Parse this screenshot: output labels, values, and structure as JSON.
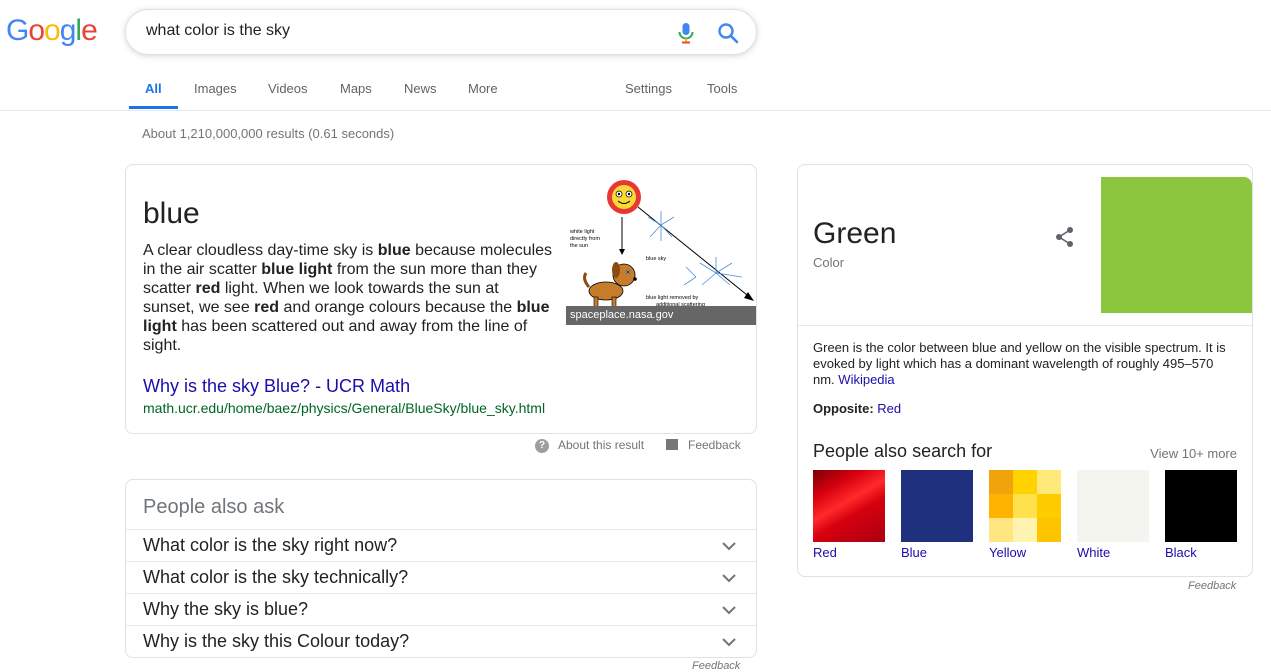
{
  "header": {
    "logo_letters": [
      {
        "ch": "G",
        "color": "#4285f4"
      },
      {
        "ch": "o",
        "color": "#ea4335"
      },
      {
        "ch": "o",
        "color": "#fbbc05"
      },
      {
        "ch": "g",
        "color": "#4285f4"
      },
      {
        "ch": "l",
        "color": "#34a853"
      },
      {
        "ch": "e",
        "color": "#ea4335"
      }
    ],
    "search_query": "what color is the sky",
    "icons": {
      "mic": "mic-icon",
      "search": "search-icon"
    }
  },
  "tabs": {
    "all": "All",
    "images": "Images",
    "videos": "Videos",
    "maps": "Maps",
    "news": "News",
    "more": "More",
    "settings": "Settings",
    "tools": "Tools",
    "active": "All",
    "accent": "#1a73e8"
  },
  "result_stats": "About 1,210,000,000 results (0.61 seconds)",
  "snippet": {
    "answer": "blue",
    "text_parts": [
      {
        "t": "A clear cloudless day-time sky is ",
        "b": false
      },
      {
        "t": "blue",
        "b": true
      },
      {
        "t": " because molecules in the air scatter ",
        "b": false
      },
      {
        "t": "blue light",
        "b": true
      },
      {
        "t": " from the sun more than they scatter ",
        "b": false
      },
      {
        "t": "red",
        "b": true
      },
      {
        "t": " light. When we look towards the sun at sunset, we see ",
        "b": false
      },
      {
        "t": "red",
        "b": true
      },
      {
        "t": " and orange colours because the ",
        "b": false
      },
      {
        "t": "blue light",
        "b": true
      },
      {
        "t": " has been scattered out and away from the line of sight.",
        "b": false
      }
    ],
    "image": {
      "label_white_light": [
        "white light",
        "directly from",
        "the sun"
      ],
      "label_blue_sky": "blue sky",
      "label_scattered": [
        "blue light removed by",
        "additional scattering"
      ]
    },
    "image_caption": "spaceplace.nasa.gov",
    "link_title": "Why is the sky Blue? - UCR Math",
    "link_url": "math.ucr.edu/home/baez/physics/General/BlueSky/blue_sky.html",
    "about_result": "About this result",
    "feedback": "Feedback"
  },
  "people_also_ask": {
    "title": "People also ask",
    "questions": [
      "What color is the sky right now?",
      "What color is the sky technically?",
      "Why the sky is blue?",
      "Why is the sky this Colour today?"
    ],
    "feedback": "Feedback"
  },
  "knowledge_panel": {
    "title": "Green",
    "subtitle": "Color",
    "swatch_color": "#8cc63f",
    "description": "Green is the color between blue and yellow on the visible spectrum. It is evoked by light which has a dominant wavelength of roughly 495–570 nm.",
    "source": "Wikipedia",
    "opposite_label": "Opposite:",
    "opposite_value": "Red",
    "people_also_search_title": "People also search for",
    "view_more": "View 10+ more",
    "related": [
      {
        "label": "Red",
        "color": "#d7000f"
      },
      {
        "label": "Blue",
        "color": "#1f307e"
      },
      {
        "label": "Yellow",
        "color": "#ffcc00"
      },
      {
        "label": "White",
        "color": "#f5f5f0"
      },
      {
        "label": "Black",
        "color": "#000000"
      }
    ],
    "feedback": "Feedback"
  }
}
